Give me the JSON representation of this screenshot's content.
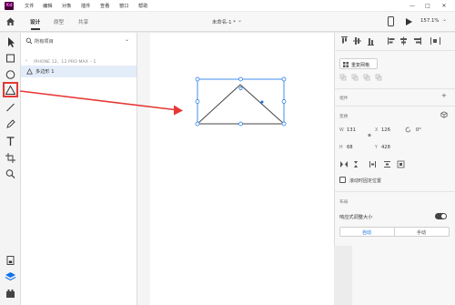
{
  "titlebar": {
    "logo_text": "Xd",
    "menus": [
      "文件",
      "编辑",
      "对象",
      "插件",
      "查看",
      "窗口",
      "帮助"
    ],
    "window_controls": [
      "—",
      "□",
      "✕"
    ]
  },
  "toolbar": {
    "tabs": [
      "设计",
      "原型",
      "共享"
    ],
    "doc_title": "未命名-1 *",
    "zoom": "157.1%"
  },
  "layers": {
    "filter_label": "所有项目",
    "artboard_name": "IPHONE 12、12 PRO MAX – 1",
    "layer_name": "多边形 1"
  },
  "right_panel": {
    "repeat_grid": "重复网格",
    "component_label": "组件",
    "transform_label": "变换",
    "w_label": "W",
    "w_value": "131",
    "x_label": "X",
    "x_value": "126",
    "h_label": "H",
    "h_value": "68",
    "y_label": "Y",
    "y_value": "428",
    "rotation_value": "0°",
    "fix_position_label": "滚动时固定位置",
    "layout_label": "布局",
    "responsive_label": "响应式调整大小",
    "auto_label": "自动",
    "manual_label": "手动"
  },
  "colors": {
    "accent": "#1473e6",
    "highlight": "#e53935",
    "logo_bg": "#470137",
    "logo_fg": "#ff61f6"
  }
}
